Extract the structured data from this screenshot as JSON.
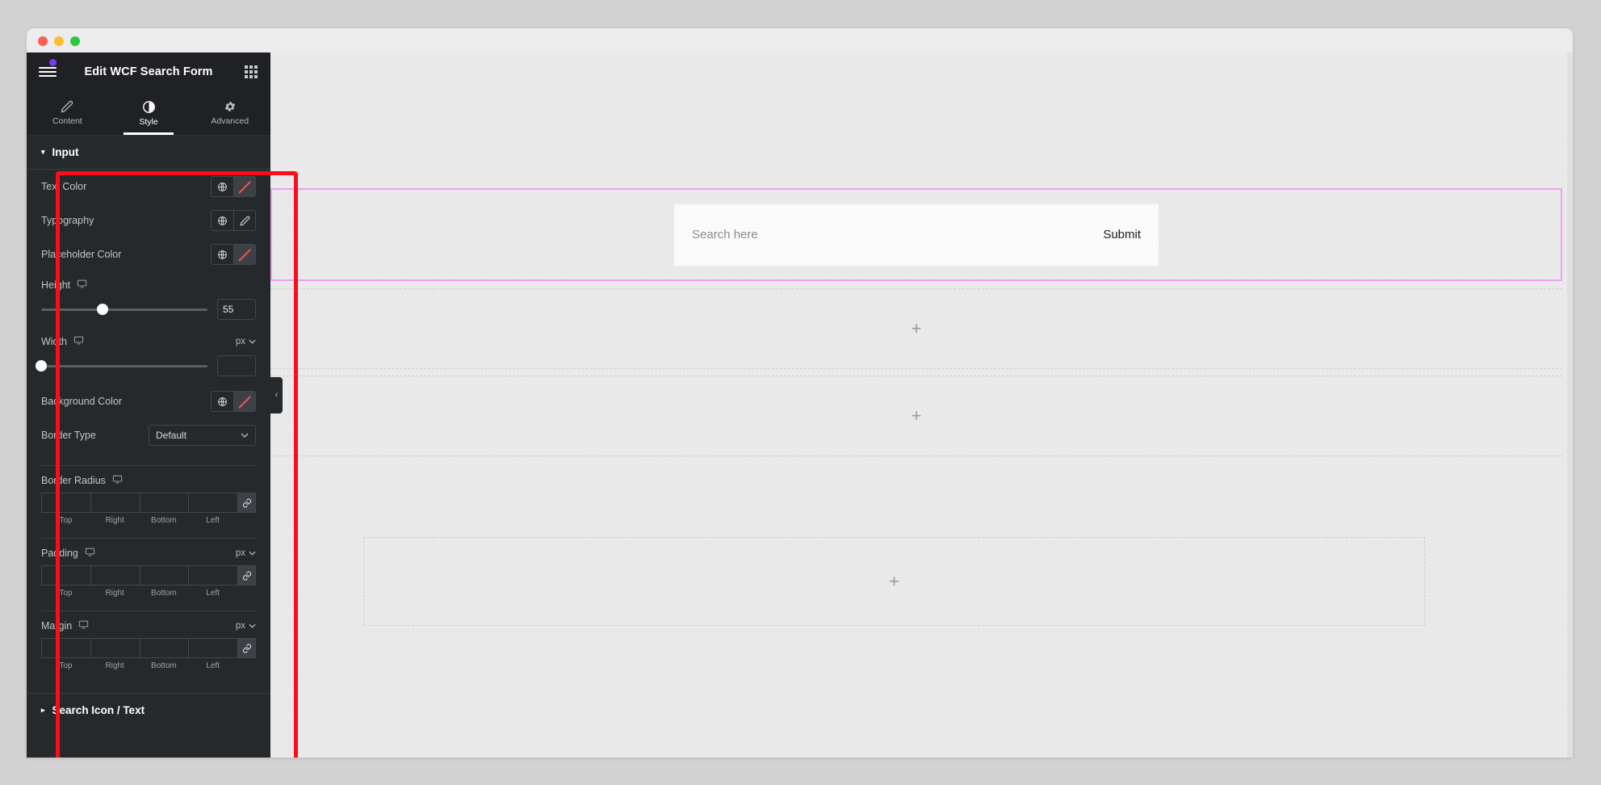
{
  "window": {
    "traffic_lights": [
      "close",
      "minimize",
      "maximize"
    ],
    "colors": {
      "close": "#ff5f57",
      "minimize": "#febc2e",
      "maximize": "#28c840"
    }
  },
  "panel": {
    "title": "Edit WCF Search Form",
    "menu_icon": "hamburger-menu-icon",
    "notification_dot_color": "#7c3aed",
    "apps_icon": "grid-apps-icon",
    "tabs": [
      {
        "label": "Content",
        "icon": "pencil-icon",
        "active": false
      },
      {
        "label": "Style",
        "icon": "contrast-circle-icon",
        "active": true
      },
      {
        "label": "Advanced",
        "icon": "gear-icon",
        "active": false
      }
    ],
    "highlight_color": "#fc0d1b",
    "sections": [
      {
        "title": "Input",
        "expanded": true,
        "controls": [
          {
            "type": "color",
            "label": "Text Color",
            "has_pencil": false
          },
          {
            "type": "color",
            "label": "Typography",
            "has_pencil": true
          },
          {
            "type": "color",
            "label": "Placeholder Color",
            "has_pencil": false
          },
          {
            "type": "slider",
            "label": "Height",
            "value": "55",
            "knob_pct": 37,
            "unit": ""
          },
          {
            "type": "slider",
            "label": "Width",
            "value": "",
            "knob_pct": 0,
            "unit": "px"
          },
          {
            "type": "color",
            "label": "Background Color",
            "has_pencil": false
          },
          {
            "type": "select",
            "label": "Border Type",
            "value": "Default"
          },
          {
            "type": "dimensions",
            "label": "Border Radius",
            "unit": "",
            "fields": [
              "",
              "",
              "",
              ""
            ],
            "sides": [
              "Top",
              "Right",
              "Bottom",
              "Left"
            ]
          },
          {
            "type": "dimensions",
            "label": "Padding",
            "unit": "px",
            "fields": [
              "",
              "",
              "",
              ""
            ],
            "sides": [
              "Top",
              "Right",
              "Bottom",
              "Left"
            ]
          },
          {
            "type": "dimensions",
            "label": "Margin",
            "unit": "px",
            "fields": [
              "",
              "",
              "",
              ""
            ],
            "sides": [
              "Top",
              "Right",
              "Bottom",
              "Left"
            ]
          }
        ]
      },
      {
        "title": "Search Icon / Text",
        "expanded": false,
        "controls": []
      }
    ]
  },
  "canvas": {
    "selected_section_border_color": "#ef9ff1",
    "search_form": {
      "placeholder": "Search here",
      "submit_label": "Submit"
    },
    "empty_sections": [
      {
        "icon": "plus-icon",
        "label": "+"
      },
      {
        "icon": "plus-icon",
        "label": "+"
      },
      {
        "icon": "plus-icon",
        "label": "+"
      }
    ],
    "collapse_handle_icon": "chevron-left-icon",
    "collapse_handle_glyph": "‹"
  },
  "labels": {
    "input_section": "Input",
    "search_icon_text_section": "Search Icon / Text",
    "text_color": "Text Color",
    "typography": "Typography",
    "placeholder_color": "Placeholder Color",
    "height": "Height",
    "width": "Width",
    "background_color": "Background Color",
    "border_type": "Border Type",
    "border_radius": "Border Radius",
    "padding": "Padding",
    "margin": "Margin",
    "top": "Top",
    "right": "Right",
    "bottom": "Bottom",
    "left": "Left",
    "px": "px",
    "default": "Default",
    "height_value": "55",
    "caret_down": "▾",
    "caret_right": "▸",
    "chevron": "⌄",
    "plus": "+"
  }
}
